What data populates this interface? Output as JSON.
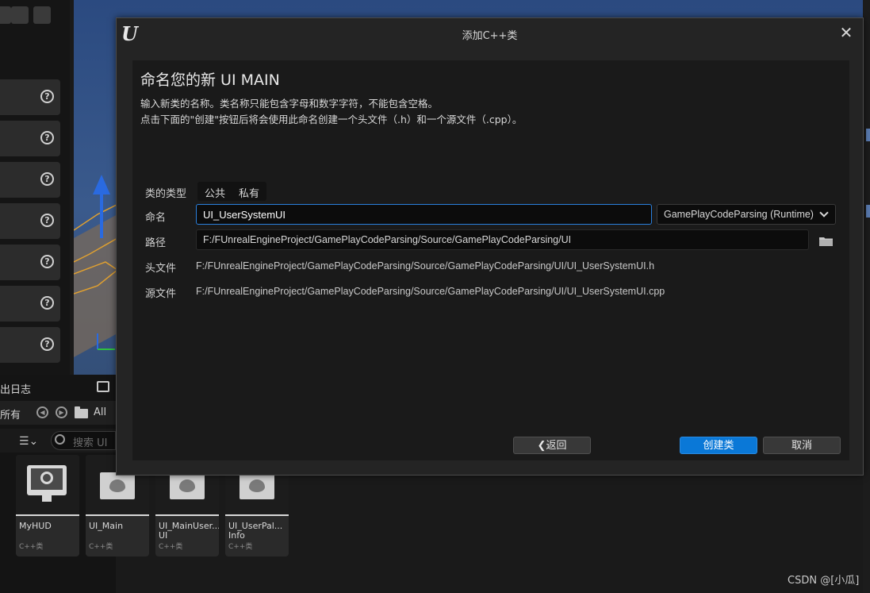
{
  "dialog": {
    "title": "添加C++类",
    "heading": "命名您的新 UI MAIN",
    "description_line1": "输入新类的名称。类名称只能包含字母和数字字符，不能包含空格。",
    "description_line2": "点击下面的\"创建\"按钮后将会使用此命名创建一个头文件（.h）和一个源文件（.cpp）。",
    "class_type": {
      "label": "类的类型",
      "options": [
        "公共",
        "私有"
      ]
    },
    "name": {
      "label": "命名",
      "value": "UI_UserSystemUI"
    },
    "module": {
      "selected": "GamePlayCodeParsing (Runtime)"
    },
    "path": {
      "label": "路径",
      "value": "F:/FUnrealEngineProject/GamePlayCodeParsing/Source/GamePlayCodeParsing/UI"
    },
    "header_file": {
      "label": "头文件",
      "value": "F:/FUnrealEngineProject/GamePlayCodeParsing/Source/GamePlayCodeParsing/UI/UI_UserSystemUI.h"
    },
    "source_file": {
      "label": "源文件",
      "value": "F:/FUnrealEngineProject/GamePlayCodeParsing/Source/GamePlayCodeParsing/UI/UI_UserSystemUI.cpp"
    },
    "buttons": {
      "back": "❮返回",
      "create": "创建类",
      "cancel": "取消"
    }
  },
  "background": {
    "output_log_title": "出日志",
    "nav_all_prefix": "所有",
    "nav_all": "All",
    "search_placeholder": "搜索 UI",
    "assets": [
      {
        "name": "MyHUD",
        "type": "C++类"
      },
      {
        "name": "UI_Main",
        "type": "C++类"
      },
      {
        "name": "UI_MainUser... UI",
        "type": "C++类"
      },
      {
        "name": "UI_UserPal... Info",
        "type": "C++类"
      }
    ],
    "watermark": "CSDN @[小瓜]"
  },
  "colors": {
    "accent": "#0a78d7",
    "focus_border": "#2a7fdc",
    "viewport_sky": "#3a5a8c"
  }
}
